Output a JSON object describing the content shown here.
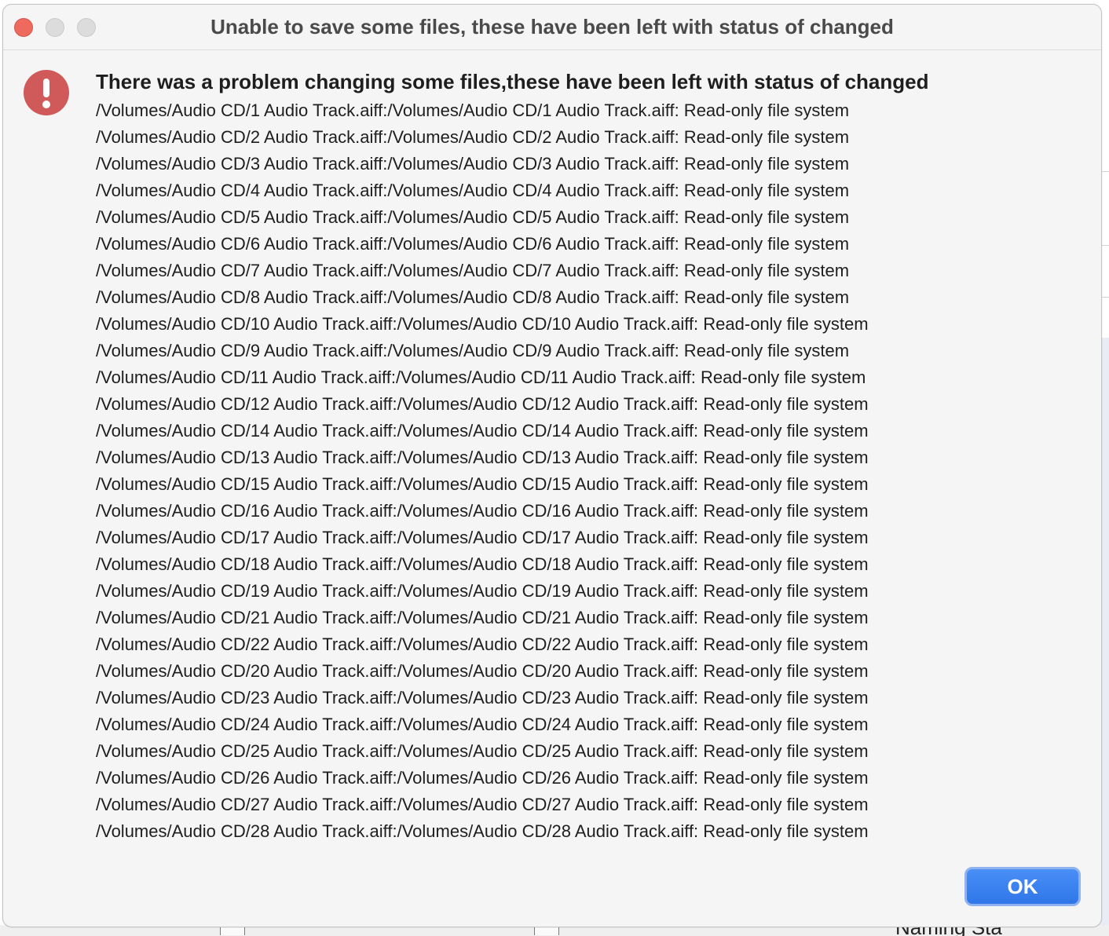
{
  "window": {
    "title": "Unable to save some files, these have been left with status of changed"
  },
  "alert": {
    "icon": "exclamation-icon",
    "icon_color": "#d05a5a",
    "heading": "There was a problem changing some files,these have been left with status of changed",
    "lines": [
      "/Volumes/Audio CD/1 Audio Track.aiff:/Volumes/Audio CD/1 Audio Track.aiff: Read-only file system",
      "/Volumes/Audio CD/2 Audio Track.aiff:/Volumes/Audio CD/2 Audio Track.aiff: Read-only file system",
      "/Volumes/Audio CD/3 Audio Track.aiff:/Volumes/Audio CD/3 Audio Track.aiff: Read-only file system",
      "/Volumes/Audio CD/4 Audio Track.aiff:/Volumes/Audio CD/4 Audio Track.aiff: Read-only file system",
      "/Volumes/Audio CD/5 Audio Track.aiff:/Volumes/Audio CD/5 Audio Track.aiff: Read-only file system",
      "/Volumes/Audio CD/6 Audio Track.aiff:/Volumes/Audio CD/6 Audio Track.aiff: Read-only file system",
      "/Volumes/Audio CD/7 Audio Track.aiff:/Volumes/Audio CD/7 Audio Track.aiff: Read-only file system",
      "/Volumes/Audio CD/8 Audio Track.aiff:/Volumes/Audio CD/8 Audio Track.aiff: Read-only file system",
      "/Volumes/Audio CD/10 Audio Track.aiff:/Volumes/Audio CD/10 Audio Track.aiff: Read-only file system",
      "/Volumes/Audio CD/9 Audio Track.aiff:/Volumes/Audio CD/9 Audio Track.aiff: Read-only file system",
      "/Volumes/Audio CD/11 Audio Track.aiff:/Volumes/Audio CD/11 Audio Track.aiff: Read-only file system",
      "/Volumes/Audio CD/12 Audio Track.aiff:/Volumes/Audio CD/12 Audio Track.aiff: Read-only file system",
      "/Volumes/Audio CD/14 Audio Track.aiff:/Volumes/Audio CD/14 Audio Track.aiff: Read-only file system",
      "/Volumes/Audio CD/13 Audio Track.aiff:/Volumes/Audio CD/13 Audio Track.aiff: Read-only file system",
      "/Volumes/Audio CD/15 Audio Track.aiff:/Volumes/Audio CD/15 Audio Track.aiff: Read-only file system",
      "/Volumes/Audio CD/16 Audio Track.aiff:/Volumes/Audio CD/16 Audio Track.aiff: Read-only file system",
      "/Volumes/Audio CD/17 Audio Track.aiff:/Volumes/Audio CD/17 Audio Track.aiff: Read-only file system",
      "/Volumes/Audio CD/18 Audio Track.aiff:/Volumes/Audio CD/18 Audio Track.aiff: Read-only file system",
      "/Volumes/Audio CD/19 Audio Track.aiff:/Volumes/Audio CD/19 Audio Track.aiff: Read-only file system",
      "/Volumes/Audio CD/21 Audio Track.aiff:/Volumes/Audio CD/21 Audio Track.aiff: Read-only file system",
      "/Volumes/Audio CD/22 Audio Track.aiff:/Volumes/Audio CD/22 Audio Track.aiff: Read-only file system",
      "/Volumes/Audio CD/20 Audio Track.aiff:/Volumes/Audio CD/20 Audio Track.aiff: Read-only file system",
      "/Volumes/Audio CD/23 Audio Track.aiff:/Volumes/Audio CD/23 Audio Track.aiff: Read-only file system",
      "/Volumes/Audio CD/24 Audio Track.aiff:/Volumes/Audio CD/24 Audio Track.aiff: Read-only file system",
      "/Volumes/Audio CD/25 Audio Track.aiff:/Volumes/Audio CD/25 Audio Track.aiff: Read-only file system",
      "/Volumes/Audio CD/26 Audio Track.aiff:/Volumes/Audio CD/26 Audio Track.aiff: Read-only file system",
      "/Volumes/Audio CD/27 Audio Track.aiff:/Volumes/Audio CD/27 Audio Track.aiff: Read-only file system",
      "/Volumes/Audio CD/28 Audio Track.aiff:/Volumes/Audio CD/28 Audio Track.aiff: Read-only file system"
    ]
  },
  "buttons": {
    "ok_label": "OK",
    "ok_color": "#3a83f1"
  },
  "background": {
    "partial_text": "Naming Sta"
  }
}
